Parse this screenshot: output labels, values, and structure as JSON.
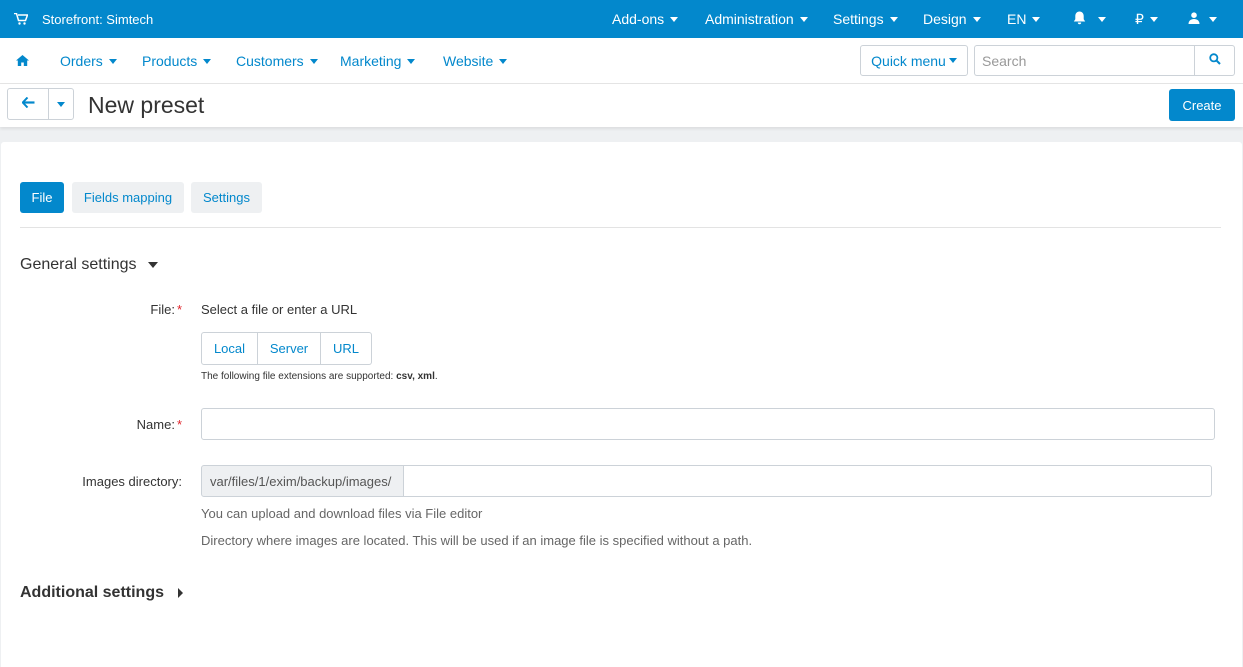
{
  "topbar": {
    "store": "Storefront: Simtech",
    "menus": [
      "Add-ons",
      "Administration",
      "Settings",
      "Design",
      "EN",
      "₽"
    ],
    "icons": [
      "cart-icon",
      "bell-icon",
      "user-icon"
    ]
  },
  "nav": {
    "items": [
      "Orders",
      "Products",
      "Customers",
      "Marketing",
      "Website"
    ],
    "quick_menu": "Quick menu",
    "search_placeholder": "Search"
  },
  "header": {
    "title": "New preset",
    "create_label": "Create"
  },
  "tabs": [
    "File",
    "Fields mapping",
    "Settings"
  ],
  "general": {
    "title": "General settings",
    "file_label": "File:",
    "file_prompt": "Select a file or enter a URL",
    "sources": [
      "Local",
      "Server",
      "URL"
    ],
    "ext_hint_prefix": "The following file extensions are supported: ",
    "ext_hint_exts": "csv, xml",
    "ext_hint_suffix": ".",
    "name_label": "Name:",
    "name_value": "",
    "images_label": "Images directory:",
    "images_prefix": "var/files/1/exim/backup/images/",
    "images_value": "",
    "help1": "You can upload and download files via File editor",
    "help2": "Directory where images are located. This will be used if an image file is specified without a path."
  },
  "additional": {
    "title": "Additional settings"
  },
  "colors": {
    "accent": "#0388cc",
    "required": "#e0232a"
  }
}
